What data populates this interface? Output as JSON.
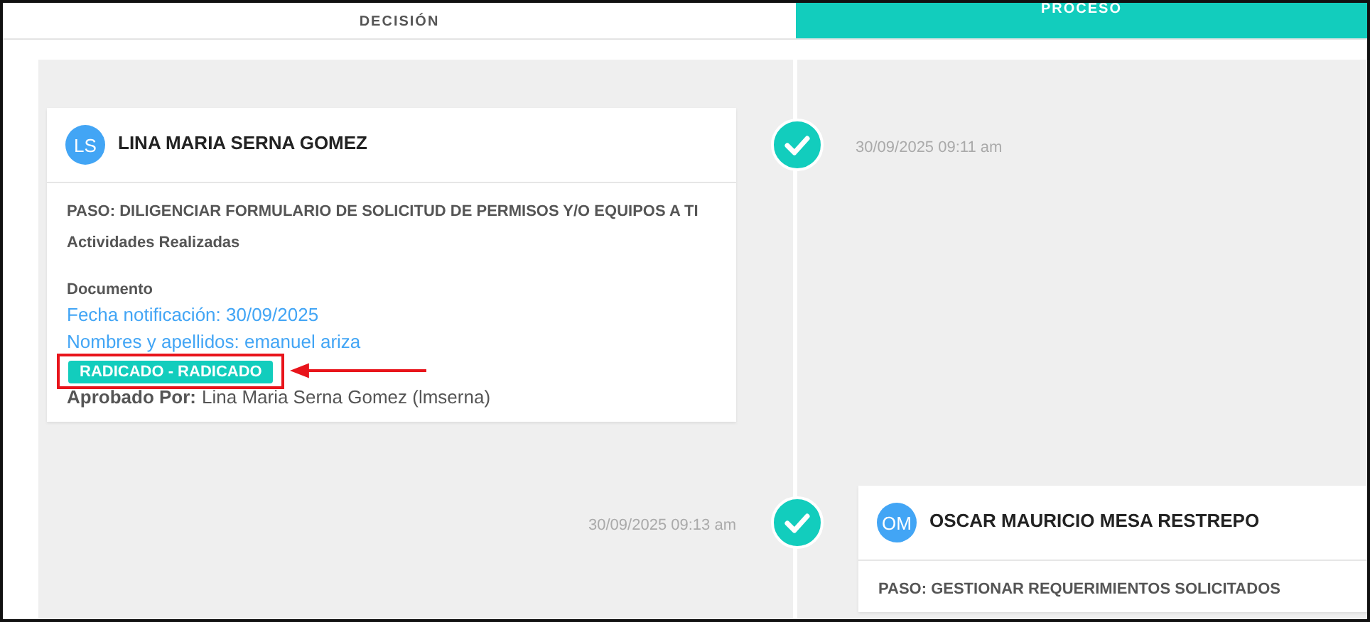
{
  "tabs": [
    {
      "label": "DECISIÓN",
      "selected": false
    },
    {
      "label": "PROCESO",
      "selected": true
    }
  ],
  "timeline": [
    {
      "kind": "left",
      "time": "30/09/2025 09:11 am",
      "done": true,
      "initials": "LS",
      "name": "LINA MARIA SERNA GOMEZ",
      "step": "PASO: DILIGENCIAR FORMULARIO DE SOLICITUD DE PERMISOS Y/O EQUIPOS A TI",
      "activities_title": "Actividades Realizadas",
      "document_title": "Documento",
      "fields": [
        "Fecha notificación: 30/09/2025",
        "Nombres y apellidos: emanuel ariza"
      ],
      "badge": {
        "label": "RADICADO - RADICADO",
        "annotated": true
      },
      "approved_label": "Aprobado Por:",
      "approved_by": "Lina Maria Serna Gomez (lmserna)"
    },
    {
      "kind": "right",
      "time": "30/09/2025 09:13 am",
      "done": true,
      "initials": "OM",
      "name": "OSCAR MAURICIO MESA RESTREPO",
      "step": "PASO: GESTIONAR REQUERIMIENTOS SOLICITADOS"
    }
  ]
}
